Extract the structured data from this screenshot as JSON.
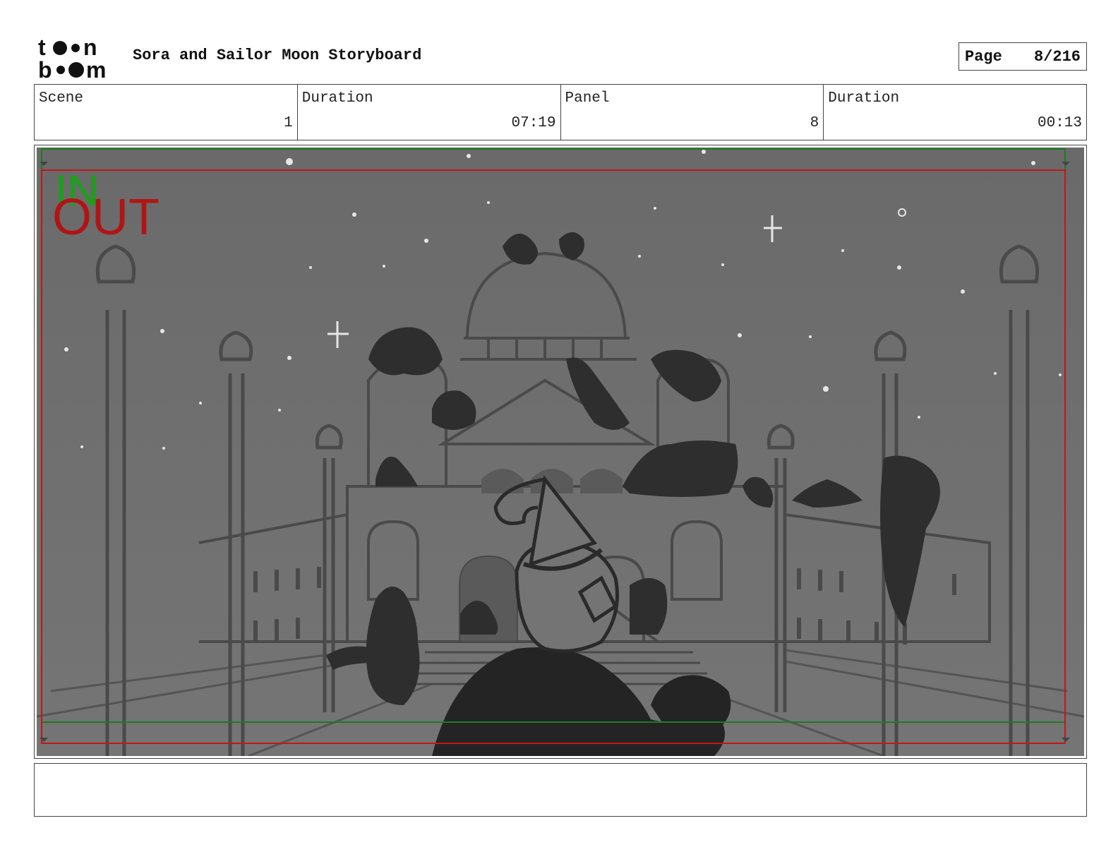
{
  "header": {
    "logo_text": "toon boom",
    "title": "Sora and Sailor Moon Storyboard",
    "page_label": "Page",
    "page_value": "8/216"
  },
  "info": {
    "scene_label": "Scene",
    "scene_value": "1",
    "scene_duration_label": "Duration",
    "scene_duration_value": "07:19",
    "panel_label": "Panel",
    "panel_value": "8",
    "panel_duration_label": "Duration",
    "panel_duration_value": "00:13"
  },
  "panel": {
    "in_marker": "IN",
    "out_marker": "OUT",
    "colors": {
      "background": "#6f6f6f",
      "sketch_line": "#4a4a4a",
      "silhouette": "#2e2e2e",
      "in_frame": "#1f7a1f",
      "out_frame": "#c01818"
    }
  },
  "notes": {
    "text": ""
  }
}
